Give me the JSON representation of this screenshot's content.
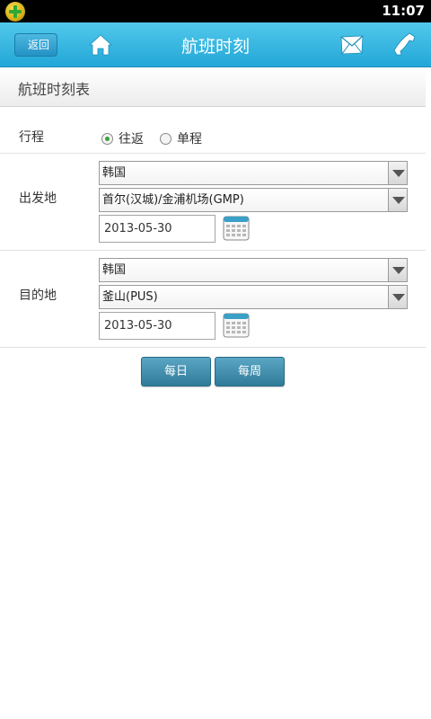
{
  "status_bar": {
    "time": "11:07"
  },
  "header": {
    "back_label": "返回",
    "title": "航班时刻"
  },
  "sub_header": {
    "title": "航班时刻表"
  },
  "trip": {
    "label": "行程",
    "options": [
      {
        "label": "往返",
        "checked": true
      },
      {
        "label": "单程",
        "checked": false
      }
    ]
  },
  "departure": {
    "label": "出发地",
    "country": "韩国",
    "airport": "首尔(汉城)/金浦机场(GMP)",
    "date": "2013-05-30"
  },
  "destination": {
    "label": "目的地",
    "country": "韩国",
    "airport": "釜山(PUS)",
    "date": "2013-05-30"
  },
  "buttons": {
    "daily": "每日",
    "weekly": "每周"
  },
  "colors": {
    "header_top": "#52c8ea",
    "header_bottom": "#22a7d8",
    "button": "#3d8aa8"
  }
}
